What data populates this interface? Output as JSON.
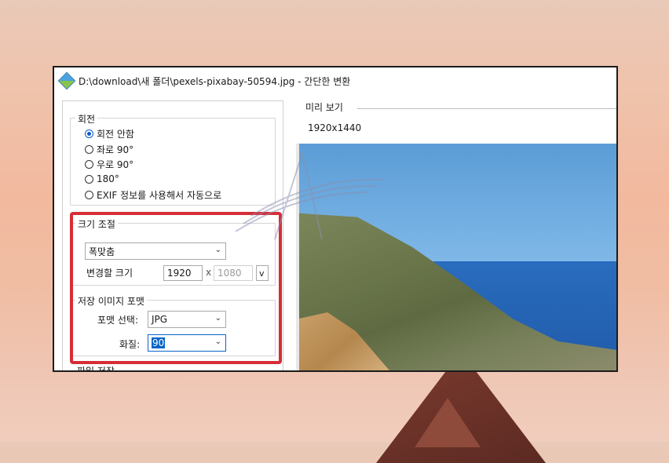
{
  "window": {
    "title": "D:\\download\\새 폴더\\pexels-pixabay-50594.jpg - 간단한 변환"
  },
  "rotation": {
    "legend": "회전",
    "options": [
      "회전 안함",
      "좌로 90°",
      "우로 90°",
      "180°",
      "EXIF 정보를 사용해서 자동으로"
    ],
    "selected": "회전 안함"
  },
  "resize": {
    "legend": "크기 조절",
    "mode_value": "폭맞춤",
    "size_label": "변경할 크기",
    "width_value": "1920",
    "separator": "x",
    "height_value": "1080",
    "options_button": "v"
  },
  "save_format": {
    "legend": "저장 이미지 포맷",
    "format_label": "포맷 선택:",
    "format_value": "JPG",
    "quality_label": "화질:",
    "quality_value": "90"
  },
  "file_save": {
    "legend": "파일 저장"
  },
  "preview": {
    "label": "미리 보기",
    "resolution": "1920x1440"
  },
  "colors": {
    "highlight_border": "#d62d37",
    "radio_selected": "#0a5bc4",
    "selection": "#0a64c8"
  }
}
